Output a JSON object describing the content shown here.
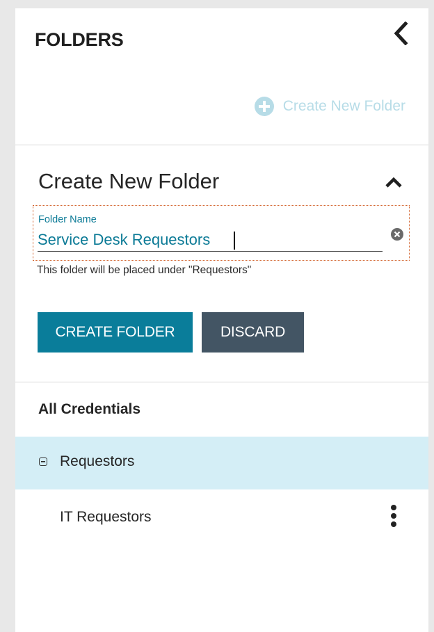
{
  "panel": {
    "title": "FOLDERS",
    "create_link_label": "Create New Folder"
  },
  "form": {
    "title": "Create New Folder",
    "field_label": "Folder Name",
    "field_value": "Service Desk Requestors",
    "hint": "This folder will be placed under \"Requestors\"",
    "create_button": "CREATE FOLDER",
    "discard_button": "DISCARD"
  },
  "tree": {
    "heading": "All Credentials",
    "items": [
      {
        "label": "Requestors",
        "selected": true,
        "expanded": true
      },
      {
        "label": "IT Requestors",
        "selected": false
      }
    ]
  },
  "icons": {
    "collapse": "chevron-left-icon",
    "create": "plus-circle-icon",
    "form_toggle": "chevron-up-icon",
    "clear": "clear-circle-icon",
    "tree_toggle": "minus-square-icon",
    "more": "kebab-menu-icon"
  },
  "colors": {
    "accent": "#0a7d9a",
    "discard": "#435564",
    "selected_row": "#d4eef6",
    "link_disabled": "#b7dce7",
    "field_focus_outline": "#d2622c"
  }
}
